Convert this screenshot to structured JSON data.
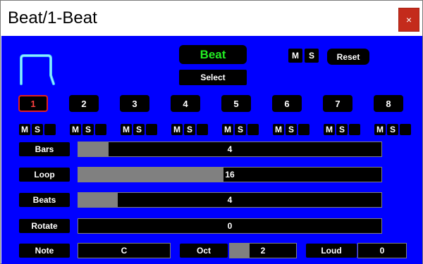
{
  "window": {
    "title": "Beat/1-Beat",
    "close_label": "×"
  },
  "header": {
    "logo_icon": "magnet-icon",
    "beat_label": "Beat",
    "select_label": "Select",
    "m_label": "M",
    "s_label": "S",
    "reset_label": "Reset"
  },
  "tracks": {
    "items": [
      {
        "label": "1",
        "active": true
      },
      {
        "label": "2"
      },
      {
        "label": "3"
      },
      {
        "label": "4"
      },
      {
        "label": "5"
      },
      {
        "label": "6"
      },
      {
        "label": "7"
      },
      {
        "label": "8"
      }
    ],
    "m_label": "M",
    "s_label": "S"
  },
  "params": {
    "bars": {
      "label": "Bars",
      "value": "4",
      "fill_fraction": 0.1
    },
    "loop": {
      "label": "Loop",
      "value": "16",
      "fill_fraction": 0.48
    },
    "beats": {
      "label": "Beats",
      "value": "4",
      "fill_fraction": 0.13
    },
    "rotate": {
      "label": "Rotate",
      "value": "0",
      "fill_fraction": 0.0
    }
  },
  "bottom": {
    "note_label": "Note",
    "note_value": "C",
    "oct_label": "Oct",
    "oct_value": "2",
    "oct_fill_fraction": 0.3,
    "loud_label": "Loud",
    "loud_value": "0"
  },
  "colors": {
    "panel": "#0000ff",
    "beat_text": "#22ee22",
    "active_track": "#e02020",
    "close": "#c42b1c"
  }
}
